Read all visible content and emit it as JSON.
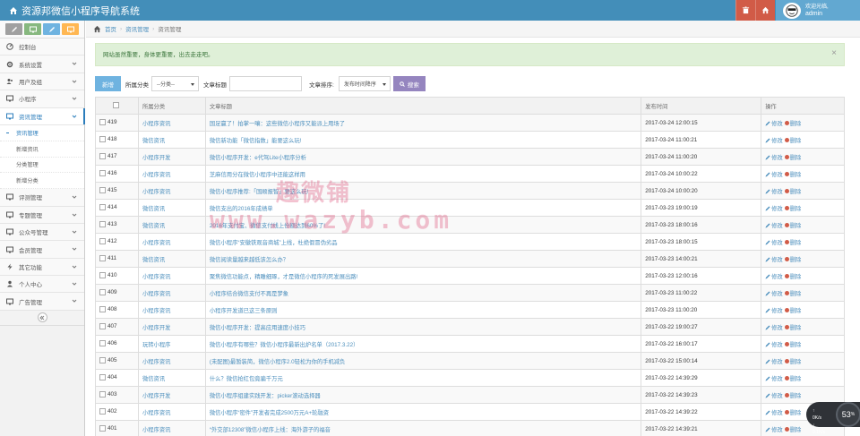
{
  "header": {
    "brand": "资源邦微信小程序导航系统",
    "user_greeting": "欢迎光临,",
    "user_name": "admin",
    "colors": {
      "navbar": "#438eb9",
      "trash": "#d15b47",
      "home": "#d15b47",
      "user": "#62a8d1"
    }
  },
  "shortcuts": [
    {
      "icon": "pencil-icon",
      "color": "#a0a0a0"
    },
    {
      "icon": "monitor-icon",
      "color": "#87b87f"
    },
    {
      "icon": "pencil-icon",
      "color": "#6fb3e0"
    },
    {
      "icon": "monitor-icon",
      "color": "#ffb752"
    }
  ],
  "sidebar": {
    "items": [
      {
        "label": "控制台",
        "icon": "dashboard-icon",
        "arrow": false
      },
      {
        "label": "系统设置",
        "icon": "gear-icon",
        "arrow": true
      },
      {
        "label": "用户及组",
        "icon": "users-icon",
        "arrow": true
      },
      {
        "label": "小程序",
        "icon": "monitor-icon",
        "arrow": true
      },
      {
        "label": "资讯管理",
        "icon": "monitor-icon",
        "arrow": true,
        "active": true
      }
    ],
    "sub_items": [
      "资讯管理",
      "新增资讯",
      "分类管理",
      "新增分类"
    ],
    "items_after": [
      {
        "label": "评测管理",
        "icon": "monitor-icon"
      },
      {
        "label": "专题管理",
        "icon": "monitor-icon"
      },
      {
        "label": "公众号管理",
        "icon": "monitor-icon"
      },
      {
        "label": "会员管理",
        "icon": "monitor-icon"
      },
      {
        "label": "其它功能",
        "icon": "bolt-icon"
      },
      {
        "label": "个人中心",
        "icon": "user-icon"
      },
      {
        "label": "广告管理",
        "icon": "monitor-icon"
      }
    ]
  },
  "breadcrumb": {
    "home": "首页",
    "section": "资讯管理",
    "current": "资讯管理"
  },
  "alert": {
    "text": "网站虽然重要，身体更重要，出去走走吧。",
    "close": "×"
  },
  "toolbar": {
    "add_label": "新增",
    "category_label": "所属分类",
    "category_value": "--分类--",
    "title_label": "文章标题",
    "sort_label": "文章排序:",
    "sort_value": "发布时间降序",
    "search_label": "搜索"
  },
  "table": {
    "headers": [
      "",
      "所属分类",
      "文章标题",
      "发布时间",
      "操作"
    ],
    "edit_label": "修改",
    "delete_label": "删除",
    "rows": [
      {
        "id": "419",
        "cat": "小程序资讯",
        "title": "国足赢了！拍掌一嚷：这些微信小程序又能派上用场了",
        "time": "2017-03-24 12:00:15"
      },
      {
        "id": "418",
        "cat": "微信资讯",
        "title": "微信新功能「微信指数」能要这么玩!",
        "time": "2017-03-24 11:00:21"
      },
      {
        "id": "417",
        "cat": "小程序开发",
        "title": "微信小程序开发：e代驾Lite小程序分析",
        "time": "2017-03-24 11:00:20"
      },
      {
        "id": "416",
        "cat": "小程序资讯",
        "title": "芝麻信用分在微信小程序中还能这样用",
        "time": "2017-03-24 10:00:22"
      },
      {
        "id": "415",
        "cat": "小程序资讯",
        "title": "微信小程序推荐:「国顺报智」要这么玩!",
        "time": "2017-03-24 10:00:20"
      },
      {
        "id": "414",
        "cat": "微信资讯",
        "title": "微信支出的2016年成绩单",
        "time": "2017-03-23 19:00:19"
      },
      {
        "id": "413",
        "cat": "微信资讯",
        "title": "2016年支付宝、微信支付线上份额达到60%了!",
        "time": "2017-03-23 18:00:16"
      },
      {
        "id": "412",
        "cat": "小程序资讯",
        "title": "微信小程序“安徽铁观音商城”上线，杜绝假冒伪劣品",
        "time": "2017-03-23 18:00:15"
      },
      {
        "id": "411",
        "cat": "微信资讯",
        "title": "微信阅读量越来越低该怎么办？",
        "time": "2017-03-23 14:00:21"
      },
      {
        "id": "410",
        "cat": "小程序资讯",
        "title": "聚焦微信功能点，精雕细琢，才是微信小程序的死发展出路!",
        "time": "2017-03-23 12:00:16"
      },
      {
        "id": "409",
        "cat": "小程序资讯",
        "title": "小程序结合微信支付不再是梦象",
        "time": "2017-03-23 11:00:22"
      },
      {
        "id": "408",
        "cat": "小程序资讯",
        "title": "小程序开发道已这三条原则",
        "time": "2017-03-23 11:00:20"
      },
      {
        "id": "407",
        "cat": "小程序开发",
        "title": "微信小程序开发：提高应用速度小技巧",
        "time": "2017-03-22 19:00:27"
      },
      {
        "id": "406",
        "cat": "玩转小程序",
        "title": "微信小程序有哪些？微信小程序最新出炉名单（2017.3.22）",
        "time": "2017-03-22 16:00:17"
      },
      {
        "id": "405",
        "cat": "小程序资讯",
        "title": "(未配图)最暂装简，微信小程序2.0轻松为你的手机减负",
        "time": "2017-03-22 15:00:14"
      },
      {
        "id": "404",
        "cat": "微信资讯",
        "title": "什么？微信抢红包竟骗千万元",
        "time": "2017-03-22 14:39:29"
      },
      {
        "id": "403",
        "cat": "小程序开发",
        "title": "微信小程序组建实践开发：picker滚动选择器",
        "time": "2017-03-22 14:39:23"
      },
      {
        "id": "402",
        "cat": "小程序资讯",
        "title": "微信小程序“密件”开发者完成2500万元A+轮融资",
        "time": "2017-03-22 14:39:22"
      },
      {
        "id": "401",
        "cat": "小程序资讯",
        "title": "“外交部12308”微信小程序上线：海外游子的福音",
        "time": "2017-03-22 14:39:21"
      }
    ]
  },
  "watermark": {
    "cn": "趣微铺",
    "url": "www.wazyb.com"
  },
  "speed_widget": {
    "up": "0K/s",
    "down": "0.1K/s",
    "percent": "53",
    "unit": "%"
  }
}
